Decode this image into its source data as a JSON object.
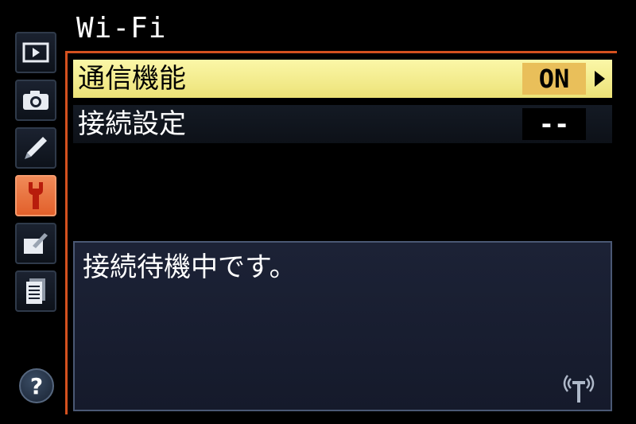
{
  "header": {
    "title": "Wi-Fi"
  },
  "tabs": [
    {
      "name": "playback-icon",
      "active": false
    },
    {
      "name": "camera-icon",
      "active": false
    },
    {
      "name": "pencil-icon",
      "active": false
    },
    {
      "name": "wrench-icon",
      "active": true
    },
    {
      "name": "retouch-icon",
      "active": false
    },
    {
      "name": "list-icon",
      "active": false
    }
  ],
  "help": {
    "label": "?"
  },
  "menu": {
    "items": [
      {
        "label": "通信機能",
        "value": "ON",
        "selected": true
      },
      {
        "label": "接続設定",
        "value": "--",
        "selected": false
      }
    ]
  },
  "message": {
    "text": "接続待機中です。",
    "icon": "wireless-antenna-icon"
  },
  "colors": {
    "accent": "#d4511f",
    "active_tab": "#e9703c",
    "selected_row": "#f5ee94",
    "selected_value_bg": "#e9bf5a",
    "panel_bg": "#181d2f"
  }
}
